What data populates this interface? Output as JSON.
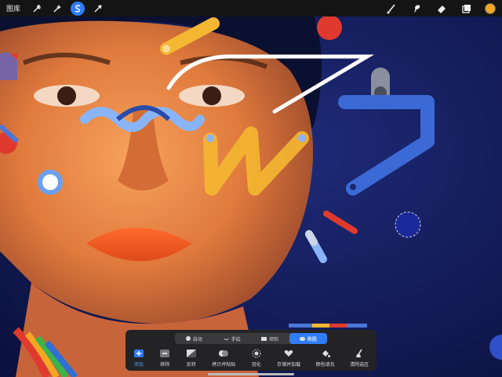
{
  "topbar": {
    "gallery_label": "图库",
    "left_tools": [
      {
        "icon": "wrench-icon",
        "name": "actions"
      },
      {
        "icon": "magic-wand-icon",
        "name": "adjustments"
      },
      {
        "icon": "selection-s-icon",
        "name": "selection",
        "active": true
      },
      {
        "icon": "arrow-cursor-icon",
        "name": "transform"
      }
    ],
    "right_tools": [
      {
        "icon": "brush-icon"
      },
      {
        "icon": "smudge-icon"
      },
      {
        "icon": "eraser-icon"
      },
      {
        "icon": "layers-icon"
      }
    ],
    "color": "#f5a623"
  },
  "selection_panel": {
    "modes": [
      {
        "label": "自动",
        "icon": "dot-icon"
      },
      {
        "label": "手绘",
        "icon": "freehand-icon"
      },
      {
        "label": "矩形",
        "icon": "rectangle-icon"
      },
      {
        "label": "椭圆",
        "icon": "ellipse-icon",
        "active": true
      }
    ],
    "actions": [
      {
        "label": "添加",
        "icon": "add-icon",
        "active": true
      },
      {
        "label": "移除",
        "icon": "remove-icon"
      },
      {
        "label": "反转",
        "icon": "invert-icon"
      },
      {
        "label": "拷贝并粘贴",
        "icon": "copy-paste-icon"
      },
      {
        "label": "羽化",
        "icon": "feather-icon"
      },
      {
        "label": "存储并加载",
        "icon": "heart-icon"
      },
      {
        "label": "颜色填充",
        "icon": "fill-icon"
      },
      {
        "label": "清除选区",
        "icon": "brush-clear-icon"
      }
    ]
  },
  "colors": {
    "accent": "#2f7cf6",
    "panel": "#232325",
    "topbar": "#141414"
  }
}
